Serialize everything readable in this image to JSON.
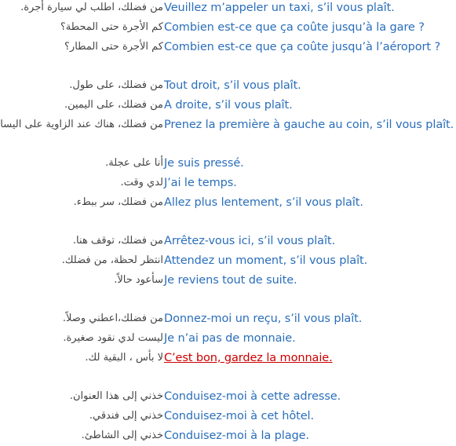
{
  "groups": [
    {
      "phrases": [
        {
          "arabic": "من فضلك، اطلب لي سيارة أجرة.",
          "french": "Veuillez m’appeler un taxi, s’il vous plaît."
        },
        {
          "arabic": "كم الأجرة حتى المحطة؟",
          "french": "Combien est-ce que ça coûte jusqu’à la gare ?"
        },
        {
          "arabic": "كم الأجرة حتى المطار؟",
          "french": "Combien est-ce que ça coûte jusqu’à l’aéroport ?"
        }
      ]
    },
    {
      "phrases": [
        {
          "arabic": "من فضلك، على طول.",
          "french": "Tout droit, s’il vous plaît."
        },
        {
          "arabic": "من فضلك، على اليمين.",
          "french": "A droite, s’il vous plaît."
        },
        {
          "arabic": "من فضلك، هناك عند الزاوية على اليسار.",
          "french": "Prenez la première à gauche au coin, s’il vous plaît."
        }
      ]
    },
    {
      "phrases": [
        {
          "arabic": "أنا على عجلة.",
          "french": "Je suis pressé."
        },
        {
          "arabic": "لدي وقت.",
          "french": "J’ai le temps."
        },
        {
          "arabic": "من فضلك، سر ببطء.",
          "french": "Allez plus lentement, s’il vous plaît."
        }
      ]
    },
    {
      "phrases": [
        {
          "arabic": "من فضلك، توقف هنا.",
          "french": "Arrêtez-vous ici, s’il vous plaît."
        },
        {
          "arabic": "انتظر لحظة، من فضلك.",
          "french": "Attendez un moment, s’il vous plaît."
        },
        {
          "arabic": "سأعود حالاً.",
          "french": "Je reviens tout de suite."
        }
      ]
    },
    {
      "phrases": [
        {
          "arabic": "من فضلك،اعطني وصلاً.",
          "french": "Donnez-moi un reçu, s’il vous plaît."
        },
        {
          "arabic": "ليست لدي نقود صغيرة.",
          "french": "Je n’ai pas de monnaie."
        },
        {
          "arabic": "لا بأس ، البقية لك.",
          "french": "C’est bon, gardez la monnaie.",
          "highlighted": true
        }
      ]
    },
    {
      "phrases": [
        {
          "arabic": "خذني إلى هذا العنوان.",
          "french": "Conduisez-moi à cette adresse."
        },
        {
          "arabic": "خذني إلى فندقي.",
          "french": "Conduisez-moi à cet hôtel."
        },
        {
          "arabic": "خذني إلى الشاطئ.",
          "french": "Conduisez-moi à la plage."
        }
      ]
    }
  ],
  "colors": {
    "french_text": "#2a6ebb",
    "arabic_text": "#444444",
    "highlight_text": "#cc0000",
    "background": "#ffffff"
  }
}
